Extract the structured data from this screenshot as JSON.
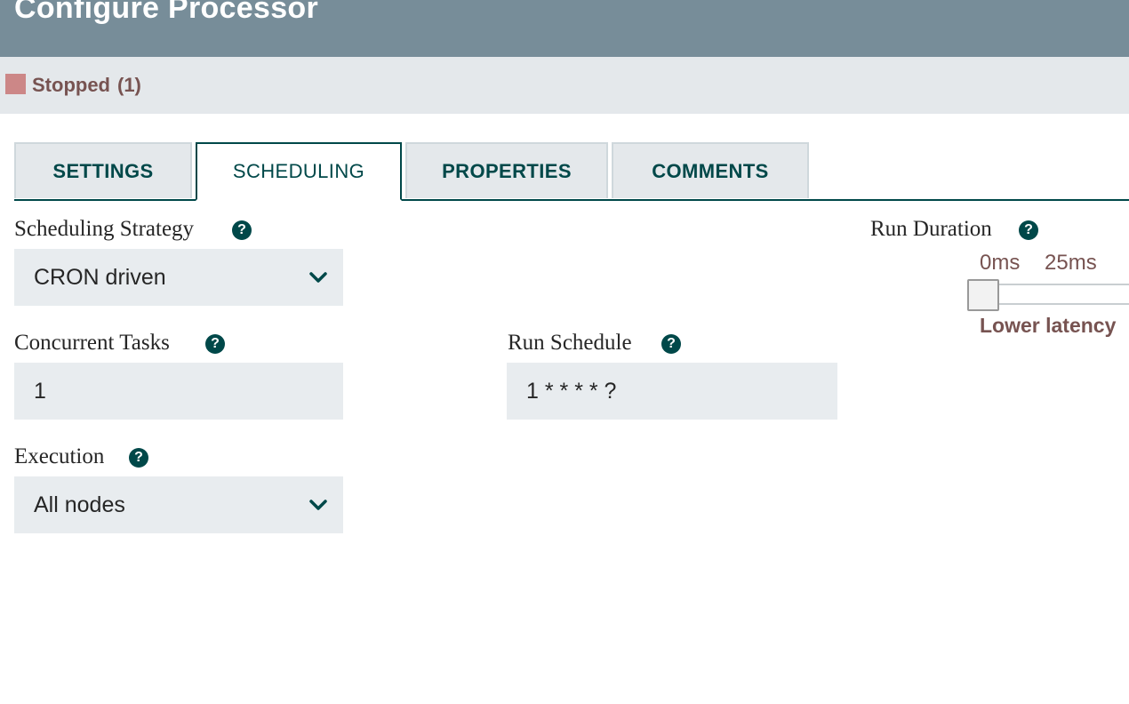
{
  "dialog": {
    "title": "Configure Processor"
  },
  "status": {
    "label": "Stopped",
    "count": "(1)",
    "color": "#cc8787"
  },
  "tabs": [
    {
      "label": "SETTINGS",
      "active": false
    },
    {
      "label": "SCHEDULING",
      "active": true
    },
    {
      "label": "PROPERTIES",
      "active": false
    },
    {
      "label": "COMMENTS",
      "active": false
    }
  ],
  "scheduling_strategy": {
    "label": "Scheduling Strategy",
    "value": "CRON driven"
  },
  "concurrent_tasks": {
    "label": "Concurrent Tasks",
    "value": "1"
  },
  "run_schedule": {
    "label": "Run Schedule",
    "value": "1 * * * * ?"
  },
  "execution": {
    "label": "Execution",
    "value": "All nodes"
  },
  "run_duration": {
    "label": "Run Duration",
    "values": [
      "0ms",
      "25ms"
    ],
    "latency_label": "Lower latency",
    "slider_position": 0
  },
  "icons": {
    "help": "question-circle-icon",
    "dropdown": "chevron-down-icon"
  },
  "colors": {
    "header": "#778d99",
    "accent": "#004849",
    "status_text": "#775351"
  }
}
